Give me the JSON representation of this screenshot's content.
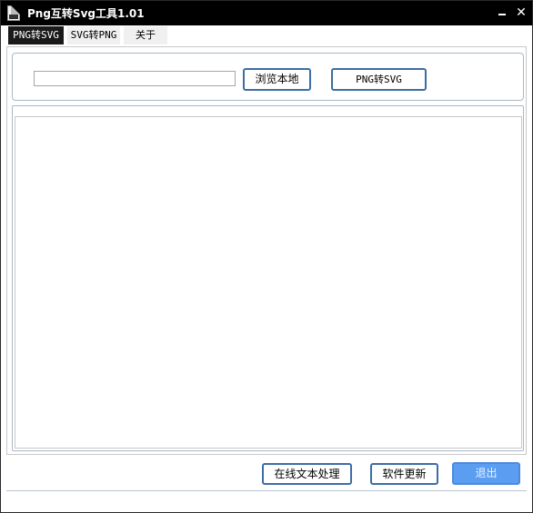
{
  "window": {
    "title": "Png互转Svg工具1.01",
    "minimize_label": "",
    "close_label": "✕"
  },
  "tabs": [
    {
      "label": "PNG转SVG",
      "active": true
    },
    {
      "label": "SVG转PNG",
      "active": false
    },
    {
      "label": "关于",
      "active": false
    }
  ],
  "toolbar": {
    "path_value": "",
    "browse_label": "浏览本地",
    "convert_label": "PNG转SVG"
  },
  "footer": {
    "online_label": "在线文本处理",
    "update_label": "软件更新",
    "exit_label": "退出"
  },
  "colors": {
    "titlebar": "#000000",
    "button_border": "#3d6da6",
    "exit_button": "#5b9df0"
  },
  "icons": {
    "app": "svg-file-icon",
    "minimize": "minimize-icon",
    "close": "close-icon"
  }
}
